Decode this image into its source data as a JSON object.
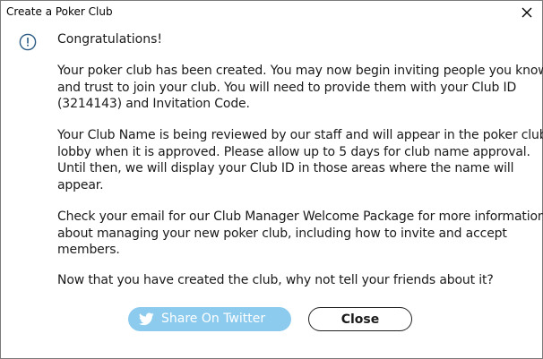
{
  "window": {
    "title": "Create a Poker Club",
    "close_glyph": "×"
  },
  "message": {
    "heading": "Congratulations!",
    "paragraphs": [
      {
        "lines": [
          "Your poker club has been created. You may now begin inviting people you know",
          "and trust to join your club. You will need to provide them with your Club ID",
          "(3214143) and Invitation Code."
        ]
      },
      {
        "lines": [
          "Your Club Name is being reviewed by our staff and will appear in the poker club",
          "lobby when it is approved. Please allow up to 5 days for club name approval.",
          "Until then, we will display your Club ID in those areas where the name will",
          "appear."
        ]
      },
      {
        "lines": [
          "Check your email for our Club Manager Welcome Package for more information",
          "about managing your new poker club, including how to invite and accept",
          "members."
        ]
      },
      {
        "lines": [
          "Now that you have created the club, why not tell your friends about it?"
        ]
      }
    ]
  },
  "buttons": {
    "share_label": "Share On Twitter",
    "close_label": "Close"
  },
  "icons": {
    "info": "info-icon",
    "twitter": "twitter-bird-icon",
    "close": "close-icon"
  },
  "colors": {
    "twitter_button": "#8ccbee",
    "info_icon": "#2b5b84",
    "text": "#1a1a1a"
  }
}
